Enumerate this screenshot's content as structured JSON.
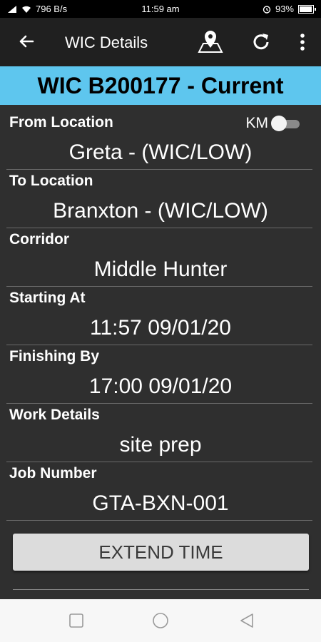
{
  "status": {
    "speed": "796 B/s",
    "time": "11:59 am",
    "battery": "93%",
    "battery_level": 0.93
  },
  "header": {
    "title": "WIC Details",
    "back_icon": "back-arrow-icon",
    "map_icon": "map-pin-icon",
    "refresh_icon": "refresh-icon",
    "menu_icon": "more-vert-icon"
  },
  "banner": {
    "text": "WIC B200177 - Current",
    "color": "#5ec6ee"
  },
  "units_toggle": {
    "label": "KM",
    "on": false
  },
  "fields": [
    {
      "label": "From Location",
      "value": "Greta - (WIC/LOW)"
    },
    {
      "label": "To Location",
      "value": "Branxton - (WIC/LOW)"
    },
    {
      "label": "Corridor",
      "value": "Middle Hunter"
    },
    {
      "label": "Starting At",
      "value": "11:57 09/01/20"
    },
    {
      "label": "Finishing By",
      "value": "17:00 09/01/20"
    },
    {
      "label": "Work Details",
      "value": "site prep"
    },
    {
      "label": "Job Number",
      "value": "GTA-BXN-001"
    }
  ],
  "actions": {
    "extend_label": "EXTEND TIME"
  }
}
